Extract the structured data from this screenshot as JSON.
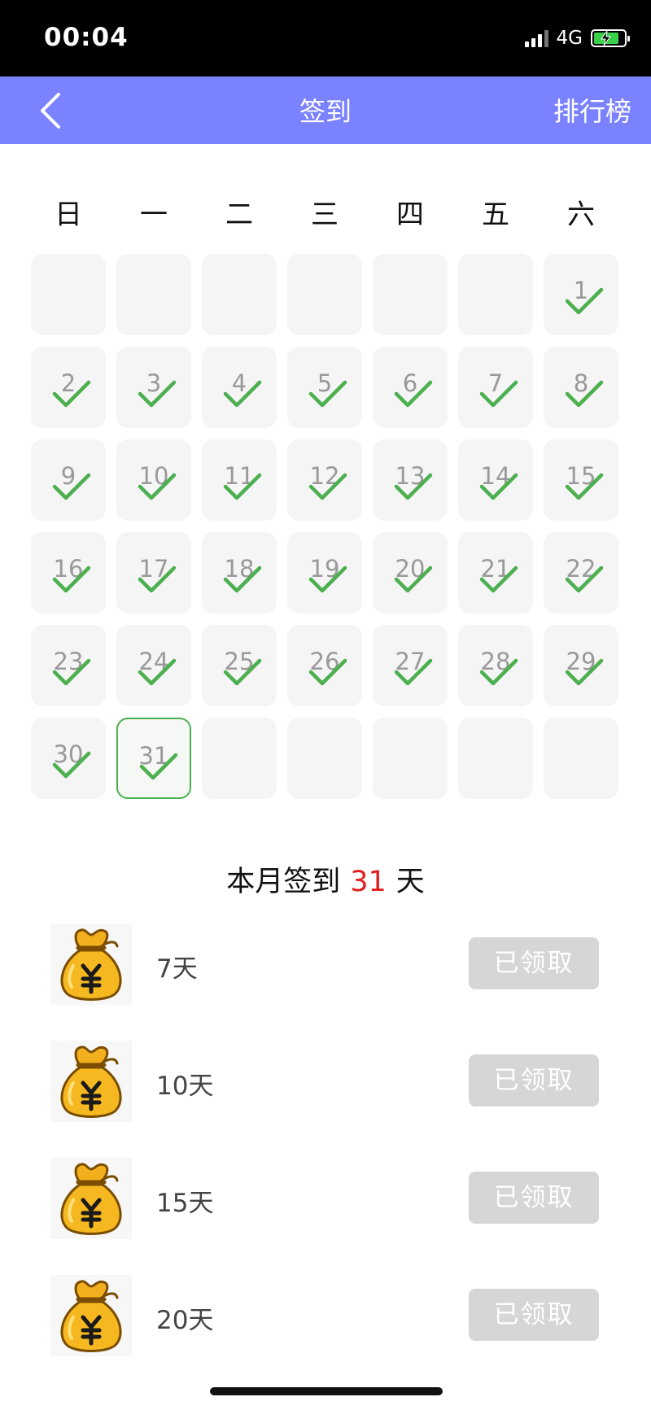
{
  "status_bar": {
    "time": "00:04",
    "network": "4G"
  },
  "nav": {
    "title": "签到",
    "right_action": "排行榜"
  },
  "calendar": {
    "weekdays": [
      "日",
      "一",
      "二",
      "三",
      "四",
      "五",
      "六"
    ],
    "days": [
      {
        "day": ""
      },
      {
        "day": ""
      },
      {
        "day": ""
      },
      {
        "day": ""
      },
      {
        "day": ""
      },
      {
        "day": ""
      },
      {
        "day": "1",
        "checked": true
      },
      {
        "day": "2",
        "checked": true
      },
      {
        "day": "3",
        "checked": true
      },
      {
        "day": "4",
        "checked": true
      },
      {
        "day": "5",
        "checked": true
      },
      {
        "day": "6",
        "checked": true
      },
      {
        "day": "7",
        "checked": true
      },
      {
        "day": "8",
        "checked": true
      },
      {
        "day": "9",
        "checked": true
      },
      {
        "day": "10",
        "checked": true
      },
      {
        "day": "11",
        "checked": true
      },
      {
        "day": "12",
        "checked": true
      },
      {
        "day": "13",
        "checked": true
      },
      {
        "day": "14",
        "checked": true
      },
      {
        "day": "15",
        "checked": true
      },
      {
        "day": "16",
        "checked": true
      },
      {
        "day": "17",
        "checked": true
      },
      {
        "day": "18",
        "checked": true
      },
      {
        "day": "19",
        "checked": true
      },
      {
        "day": "20",
        "checked": true
      },
      {
        "day": "21",
        "checked": true
      },
      {
        "day": "22",
        "checked": true
      },
      {
        "day": "23",
        "checked": true
      },
      {
        "day": "24",
        "checked": true
      },
      {
        "day": "25",
        "checked": true
      },
      {
        "day": "26",
        "checked": true
      },
      {
        "day": "27",
        "checked": true
      },
      {
        "day": "28",
        "checked": true
      },
      {
        "day": "29",
        "checked": true
      },
      {
        "day": "30",
        "checked": true
      },
      {
        "day": "31",
        "checked": true,
        "today": true
      },
      {
        "day": ""
      },
      {
        "day": ""
      },
      {
        "day": ""
      },
      {
        "day": ""
      },
      {
        "day": ""
      }
    ],
    "check_color": "#4caf50"
  },
  "summary": {
    "prefix": "本月签到",
    "count": "31",
    "suffix": "天"
  },
  "rewards": [
    {
      "label": "7天",
      "button": "已领取",
      "icon": "money-bag-icon"
    },
    {
      "label": "10天",
      "button": "已领取",
      "icon": "money-bag-icon"
    },
    {
      "label": "15天",
      "button": "已领取",
      "icon": "money-bag-icon"
    },
    {
      "label": "20天",
      "button": "已领取",
      "icon": "money-bag-icon"
    }
  ],
  "colors": {
    "nav_bar": "#7a82ff",
    "count_highlight": "#e02020",
    "claimed_button": "#d6d6d6"
  }
}
